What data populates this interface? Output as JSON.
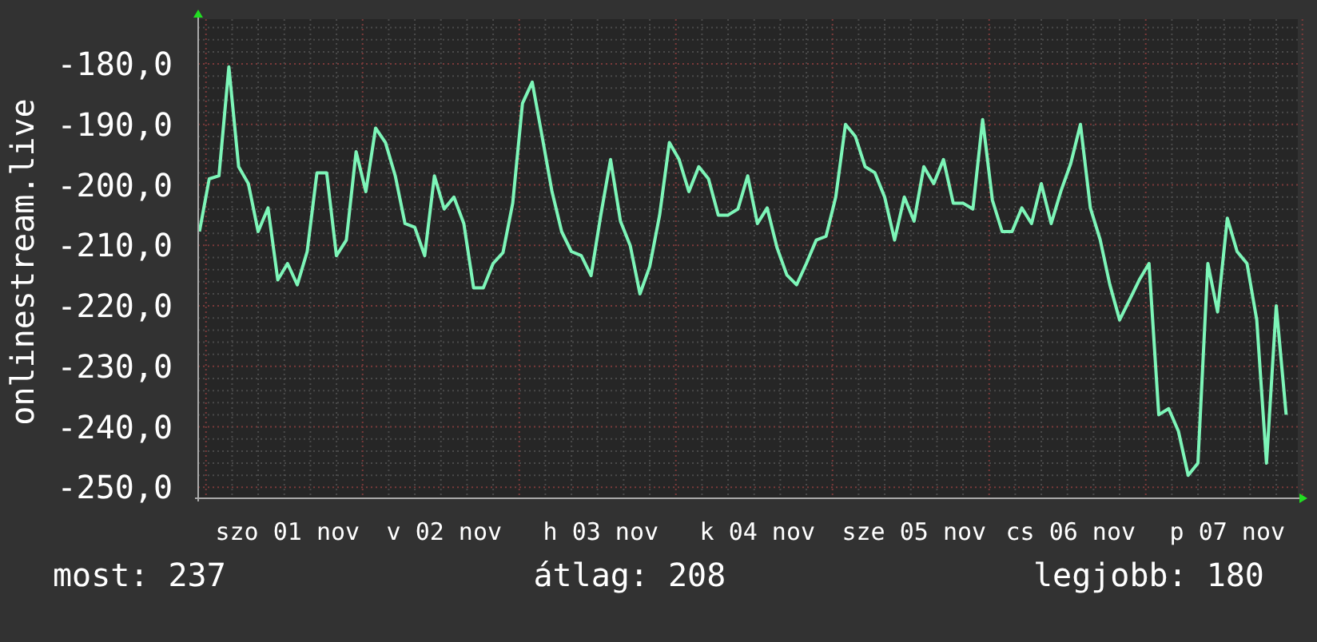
{
  "chart": {
    "chart_data": {
      "type": "line",
      "ylabel": "onlinestream.live",
      "categories": [
        null,
        null,
        null,
        null,
        null,
        null,
        null,
        null,
        null,
        "szo 01 nov",
        null,
        null,
        null,
        null,
        null,
        null,
        null,
        null,
        null,
        null,
        null,
        null,
        null,
        null,
        null,
        "v 02 nov",
        null,
        null,
        null,
        null,
        null,
        null,
        null,
        null,
        null,
        null,
        null,
        null,
        null,
        null,
        null,
        "h 03 nov",
        null,
        null,
        null,
        null,
        null,
        null,
        null,
        null,
        null,
        null,
        null,
        null,
        null,
        null,
        null,
        "k 04 nov",
        null,
        null,
        null,
        null,
        null,
        null,
        null,
        null,
        null,
        null,
        null,
        null,
        null,
        null,
        null,
        "sze 05 nov",
        null,
        null,
        null,
        null,
        null,
        null,
        null,
        null,
        null,
        null,
        null,
        null,
        null,
        null,
        null,
        "cs 06 nov",
        null,
        null,
        null,
        null,
        null,
        null,
        null,
        null,
        null,
        null,
        null,
        null,
        null,
        null,
        null,
        "p 07 nov",
        null,
        null,
        null,
        null,
        null,
        null
      ],
      "series": [
        {
          "color": "#7df5b8",
          "values": [
            -207.7,
            -199,
            -198.5,
            -180.5,
            -197,
            -199.8,
            -207.7,
            -203.8,
            -215.7,
            -213,
            -216.5,
            -211,
            -198,
            -198,
            -211.7,
            -209.1,
            -194.5,
            -201.1,
            -190.6,
            -193,
            -198.5,
            -206.4,
            -207,
            -211.7,
            -198.5,
            -204,
            -202,
            -206.4,
            -217,
            -217,
            -213,
            -211.2,
            -203,
            -186.5,
            -183,
            -192,
            -201,
            -207.7,
            -211,
            -211.7,
            -215,
            -205,
            -195.8,
            -206,
            -210,
            -218,
            -213.5,
            -205,
            -193,
            -195.8,
            -201.1,
            -197,
            -199,
            -205,
            -205,
            -204,
            -198.5,
            -206.4,
            -203.8,
            -210.4,
            -214.9,
            -216.5,
            -213,
            -209.1,
            -208.5,
            -202,
            -190,
            -192,
            -197,
            -198,
            -202,
            -209.1,
            -202,
            -206,
            -197,
            -199.8,
            -195.8,
            -203,
            -203,
            -204,
            -189.2,
            -202.5,
            -207.7,
            -207.7,
            -203.8,
            -206.4,
            -199.8,
            -206.4,
            -201,
            -196.5,
            -190,
            -203.8,
            -209,
            -216.5,
            -222.3,
            -219,
            -215.7,
            -213,
            -238,
            -237,
            -240.7,
            -248,
            -246,
            -213,
            -221,
            -205.5,
            -211,
            -213,
            -222.3,
            -246,
            -220,
            -238
          ]
        }
      ],
      "grid": true,
      "ylim": [
        -251.8,
        -172.6
      ],
      "yticks": [
        {
          "value": -180,
          "label": "-180,0"
        },
        {
          "value": -190,
          "label": "-190,0"
        },
        {
          "value": -200,
          "label": "-200,0"
        },
        {
          "value": -210,
          "label": "-210,0"
        },
        {
          "value": -220,
          "label": "-220,0"
        },
        {
          "value": -230,
          "label": "-230,0"
        },
        {
          "value": -240,
          "label": "-240,0"
        },
        {
          "value": -250,
          "label": "-250,0"
        }
      ]
    }
  },
  "stats": [
    "most: 237",
    "átlag: 208",
    "legjobb: 180"
  ]
}
